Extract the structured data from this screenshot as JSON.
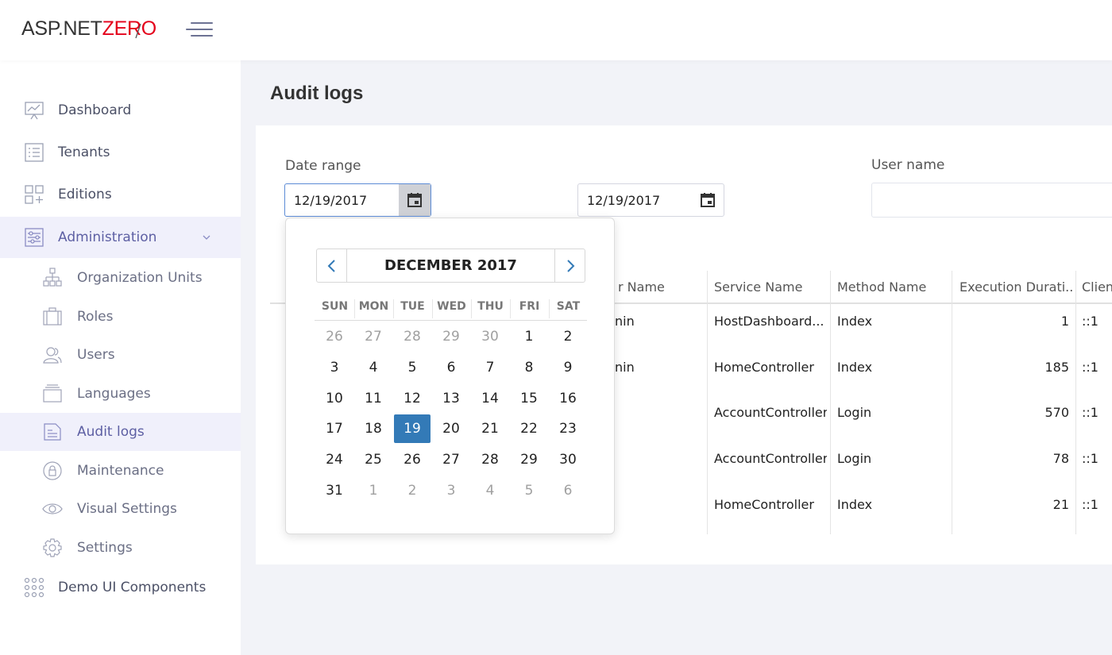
{
  "header": {
    "logo_part1": "ASP.NET",
    "logo_part2": "ZERO"
  },
  "colors": {
    "accent": "#337ab7",
    "logo_red": "#e4001b",
    "active_nav_bg": "#f0f0fb",
    "active_nav_text": "#5d5fa3"
  },
  "sidebar": {
    "items": [
      {
        "label": "Dashboard",
        "icon": "dashboard-icon"
      },
      {
        "label": "Tenants",
        "icon": "list-icon"
      },
      {
        "label": "Editions",
        "icon": "grid-plus-icon"
      },
      {
        "label": "Administration",
        "icon": "sliders-icon",
        "expanded": true
      },
      {
        "label": "Organization Units",
        "icon": "org-tree-icon"
      },
      {
        "label": "Roles",
        "icon": "briefcase-icon"
      },
      {
        "label": "Users",
        "icon": "users-icon"
      },
      {
        "label": "Languages",
        "icon": "stack-icon"
      },
      {
        "label": "Audit logs",
        "icon": "document-icon",
        "selected": true
      },
      {
        "label": "Maintenance",
        "icon": "lock-icon"
      },
      {
        "label": "Visual Settings",
        "icon": "eye-icon"
      },
      {
        "label": "Settings",
        "icon": "gear-icon"
      },
      {
        "label": "Demo UI Components",
        "icon": "dots-grid-icon"
      }
    ]
  },
  "page": {
    "title": "Audit logs"
  },
  "filters": {
    "date_range_label": "Date range",
    "start_date": "12/19/2017",
    "end_date": "12/19/2017",
    "user_name_label": "User name",
    "user_name_value": ""
  },
  "table": {
    "columns": [
      "r Name",
      "Service Name",
      "Method Name",
      "Execution Durati...",
      "Clien"
    ],
    "rows": [
      [
        "nin",
        "HostDashboard...",
        "Index",
        "1",
        "::1"
      ],
      [
        "nin",
        "HomeController",
        "Index",
        "185",
        "::1"
      ],
      [
        "",
        "AccountController",
        "Login",
        "570",
        "::1"
      ],
      [
        "",
        "AccountController",
        "Login",
        "78",
        "::1"
      ],
      [
        "",
        "HomeController",
        "Index",
        "21",
        "::1"
      ]
    ]
  },
  "datepicker": {
    "title": "DECEMBER 2017",
    "weekdays": [
      "SUN",
      "MON",
      "TUE",
      "WED",
      "THU",
      "FRI",
      "SAT"
    ],
    "weeks": [
      [
        "26",
        "27",
        "28",
        "29",
        "30",
        "1",
        "2"
      ],
      [
        "3",
        "4",
        "5",
        "6",
        "7",
        "8",
        "9"
      ],
      [
        "10",
        "11",
        "12",
        "13",
        "14",
        "15",
        "16"
      ],
      [
        "17",
        "18",
        "19",
        "20",
        "21",
        "22",
        "23"
      ],
      [
        "24",
        "25",
        "26",
        "27",
        "28",
        "29",
        "30"
      ],
      [
        "31",
        "1",
        "2",
        "3",
        "4",
        "5",
        "6"
      ]
    ],
    "selected": "19"
  }
}
